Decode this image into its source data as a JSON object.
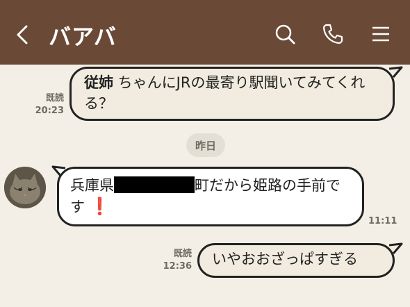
{
  "header": {
    "title": "バアバ"
  },
  "messages": [
    {
      "side": "mine",
      "read_label": "既読",
      "time": "20:23",
      "name_part": "従姉",
      "text_part": " ちゃんにJRの最寄り駅聞いてみてくれる？"
    },
    {
      "side": "date",
      "label": "昨日"
    },
    {
      "side": "theirs",
      "time": "11:11",
      "text_before": "兵庫県",
      "text_after": "町だから姫路の手前です",
      "emoji": "❗"
    },
    {
      "side": "mine",
      "read_label": "既読",
      "time": "12:36",
      "text": "いやおおざっぱすぎる"
    }
  ],
  "colors": {
    "header_bg": "#6a4a36",
    "chat_bg": "#f3efe6",
    "my_bubble": "#f1ecdf",
    "their_bubble": "#ffffff"
  }
}
